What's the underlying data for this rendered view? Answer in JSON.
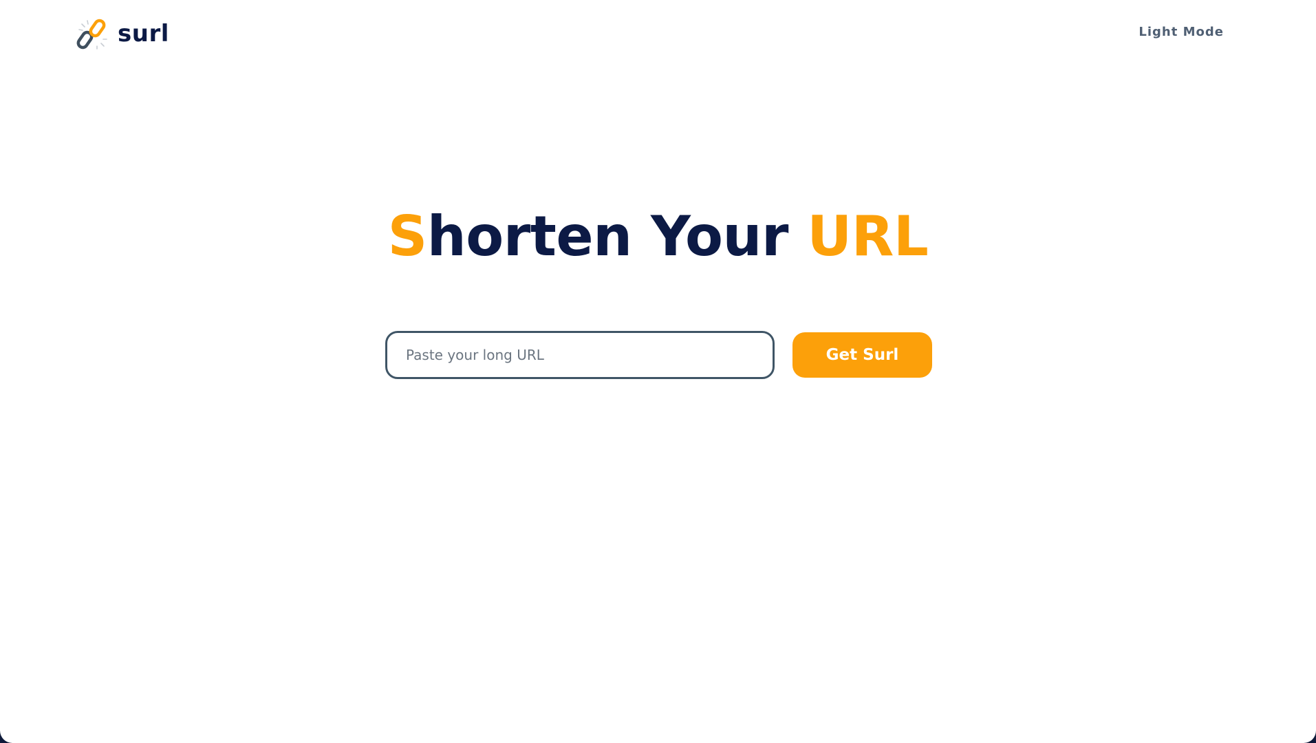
{
  "brand": {
    "name": "surl",
    "logo_icon": "chain-link-icon"
  },
  "header": {
    "mode_toggle_label": "Light Mode"
  },
  "hero": {
    "title_part1_accent": "S",
    "title_part2": "horten Your ",
    "title_part3_accent": "URL"
  },
  "form": {
    "url_input_value": "",
    "url_input_placeholder": "Paste your long URL",
    "submit_label": "Get Surl"
  },
  "colors": {
    "accent": "#fca00a",
    "navy": "#0c1a45",
    "input_border": "#3f5566",
    "muted_text": "#4f5f73"
  }
}
